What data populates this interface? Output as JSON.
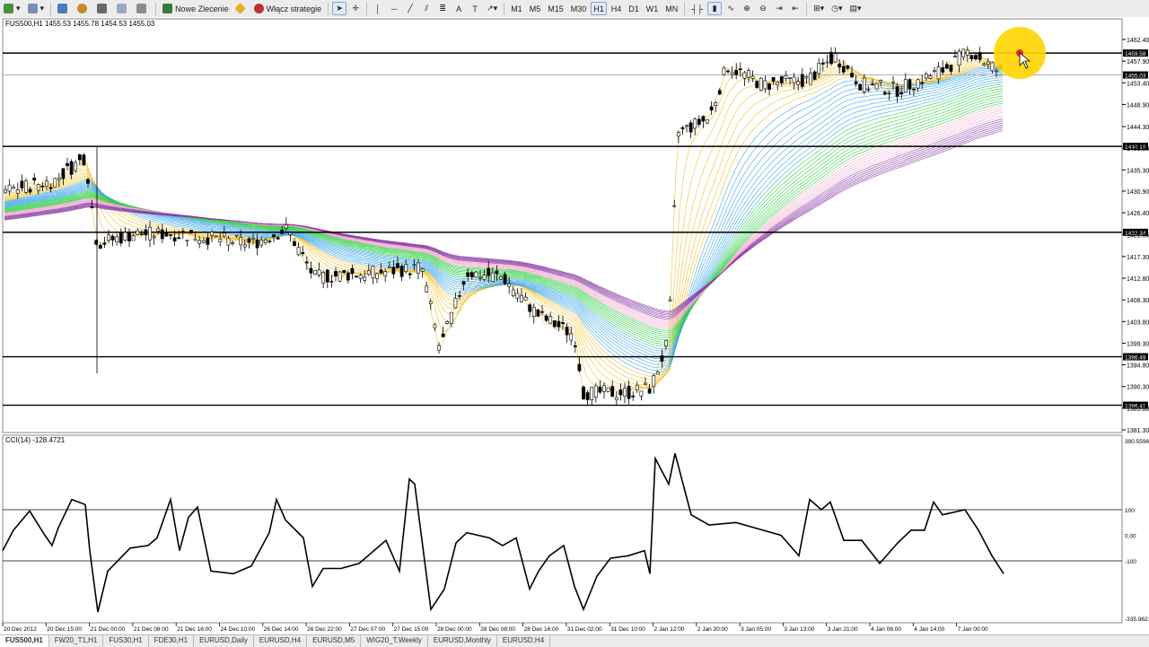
{
  "toolbar": {
    "new_order": "Nowe Zlecenie",
    "enable_strategies": "Włącz strategie",
    "timeframes": [
      "M1",
      "M5",
      "M15",
      "M30",
      "H1",
      "H4",
      "D1",
      "W1",
      "MN"
    ],
    "active_timeframe": "H1"
  },
  "chart": {
    "header": "FUS500,H1  1455.53 1455.78 1454.53 1455.03",
    "indicator_label": "CCI(14) -128.4721",
    "price_ticks": [
      "1462.40",
      "1457.90",
      "1453.40",
      "1448.90",
      "1444.30",
      "1439.80",
      "1435.30",
      "1430.90",
      "1426.40",
      "1421.85",
      "1417.30",
      "1412.80",
      "1408.30",
      "1403.80",
      "1399.30",
      "1394.80",
      "1390.30",
      "1385.80",
      "1381.30"
    ],
    "level_tags": [
      "1459.58",
      "1455.03",
      "1440.19",
      "1422.34",
      "1396.49",
      "1386.41"
    ],
    "cci_ticks": [
      "390.5596",
      "100",
      "0.00",
      "-100",
      "-335.9621"
    ],
    "time_ticks": [
      "20 Dec 2012",
      "20 Dec 15:00",
      "21 Dec 00:00",
      "21 Dec 08:00",
      "21 Dec 16:00",
      "24 Dec 10:00",
      "26 Dec 14:00",
      "26 Dec 22:00",
      "27 Dec 07:00",
      "27 Dec 15:00",
      "28 Dec 00:00",
      "28 Dec 08:00",
      "28 Dec 16:00",
      "31 Dec 02:00",
      "31 Dec 10:00",
      "2 Jan 12:00",
      "2 Jan 20:00",
      "3 Jan 05:00",
      "3 Jan 13:00",
      "3 Jan 21:00",
      "4 Jan 06:00",
      "4 Jan 14:00",
      "7 Jan 00:00"
    ],
    "colors": {
      "yellow": "#f2c02a",
      "blue": "#3aa6e8",
      "green": "#2fcf46",
      "pink": "#f0a3c8",
      "purple": "#8a3aa6",
      "cursor": "#ffd400"
    }
  },
  "tabs": [
    "FUS500,H1",
    "FW20_T1,H1",
    "FUS30,H1",
    "FDE30,H1",
    "EURUSD,Daily",
    "EURUSD,H4",
    "EURUSD,M5",
    "WIG20_T,Weekly",
    "EURUSD,Monthly",
    "EURUSD,H4"
  ],
  "active_tab": "FUS500,H1"
}
